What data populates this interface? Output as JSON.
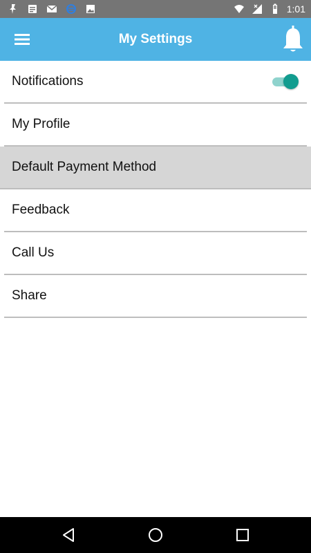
{
  "status_bar": {
    "time": "1:01",
    "left_icons": [
      "pin-icon",
      "article-icon",
      "mail-icon",
      "sync-icon",
      "image-icon"
    ],
    "right_icons": [
      "wifi-icon",
      "signal-icon",
      "battery-icon"
    ]
  },
  "app_bar": {
    "title": "My Settings",
    "menu_icon": "hamburger-menu-icon",
    "bell_icon": "bell-icon",
    "background": "#4fb3e4"
  },
  "settings": {
    "items": [
      {
        "label": "Notifications",
        "toggle": true
      },
      {
        "label": "My Profile"
      },
      {
        "label": "Default Payment Method",
        "selected": true
      },
      {
        "label": "Feedback"
      },
      {
        "label": "Call Us"
      },
      {
        "label": "Share"
      }
    ]
  },
  "colors": {
    "accent": "#129c8f",
    "selected_row": "#d6d6d6",
    "status_bar": "#757575"
  },
  "nav_bar": {
    "buttons": [
      "back-icon",
      "home-icon",
      "recents-icon"
    ]
  }
}
